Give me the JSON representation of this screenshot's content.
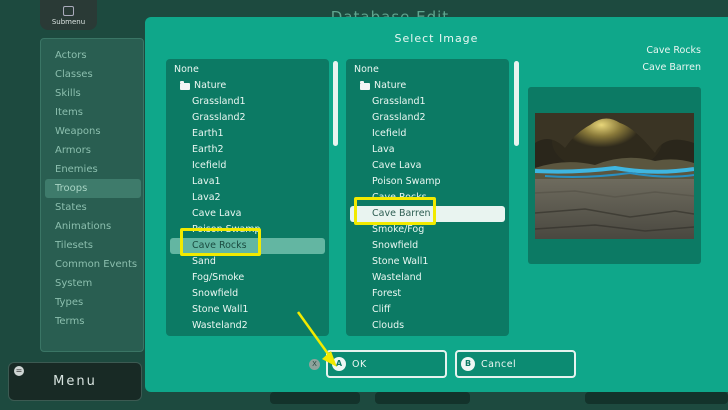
{
  "app": {
    "title": "Database Edit",
    "submenu_label": "Submenu",
    "menu_label": "Menu",
    "menu_key": "="
  },
  "sidebar": {
    "items": [
      {
        "label": "Actors"
      },
      {
        "label": "Classes"
      },
      {
        "label": "Skills"
      },
      {
        "label": "Items"
      },
      {
        "label": "Weapons"
      },
      {
        "label": "Armors"
      },
      {
        "label": "Enemies"
      },
      {
        "label": "Troops"
      },
      {
        "label": "States"
      },
      {
        "label": "Animations"
      },
      {
        "label": "Tilesets"
      },
      {
        "label": "Common Events"
      },
      {
        "label": "System"
      },
      {
        "label": "Types"
      },
      {
        "label": "Terms"
      }
    ],
    "active": "Troops"
  },
  "dialog": {
    "title": "Select Image",
    "selected_names": [
      "Cave Rocks",
      "Cave Barren"
    ],
    "list_a": {
      "none": "None",
      "folder": "Nature",
      "items": [
        "Grassland1",
        "Grassland2",
        "Earth1",
        "Earth2",
        "Icefield",
        "Lava1",
        "Lava2",
        "Cave Lava",
        "Poison Swamp",
        "Cave Rocks",
        "Sand",
        "Fog/Smoke",
        "Snowfield",
        "Stone Wall1",
        "Wasteland2"
      ],
      "selected": "Cave Rocks"
    },
    "list_b": {
      "none": "None",
      "folder": "Nature",
      "items": [
        "Grassland1",
        "Grassland2",
        "Icefield",
        "Lava",
        "Cave Lava",
        "Poison Swamp",
        "Cave Rocks",
        "Cave Barren",
        "Smoke/Fog",
        "Snowfield",
        "Stone Wall1",
        "Wasteland",
        "Forest",
        "Cliff",
        "Clouds"
      ],
      "selected": "Cave Barren"
    },
    "buttons": {
      "ok_key": "A",
      "ok_label": "OK",
      "cancel_key": "B",
      "cancel_label": "Cancel",
      "close_key": "X"
    }
  },
  "colors": {
    "dialog_bg": "#0fa78a",
    "panel_bg": "#0c7a64",
    "highlight": "#f1ea00"
  }
}
